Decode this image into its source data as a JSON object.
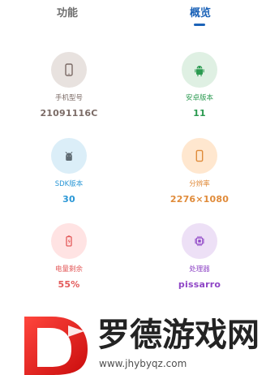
{
  "tabs": {
    "functions": "功能",
    "overview": "概览"
  },
  "items": [
    {
      "label": "手机型号",
      "value": "21091116C",
      "icon": "phone-icon"
    },
    {
      "label": "安卓版本",
      "value": "11",
      "icon": "android-icon"
    },
    {
      "label": "SDK版本",
      "value": "30",
      "icon": "sdk-icon"
    },
    {
      "label": "分辨率",
      "value": "2276×1080",
      "icon": "screen-icon"
    },
    {
      "label": "电量剩余",
      "value": "55%",
      "icon": "battery-icon"
    },
    {
      "label": "处理器",
      "value": "pissarro",
      "icon": "cpu-icon"
    }
  ],
  "watermark": {
    "logo": "D",
    "title": "罗德游戏网",
    "url": "www.jhybyqz.com"
  },
  "colors": {
    "tab_active": "#1c63b8",
    "tab_inactive": "#6f6f6f",
    "model": "#7b6b66",
    "android": "#2b9a50",
    "sdk": "#2a97d6",
    "resolution": "#e08b3a",
    "battery": "#e35a5a",
    "cpu": "#8f46c6"
  }
}
